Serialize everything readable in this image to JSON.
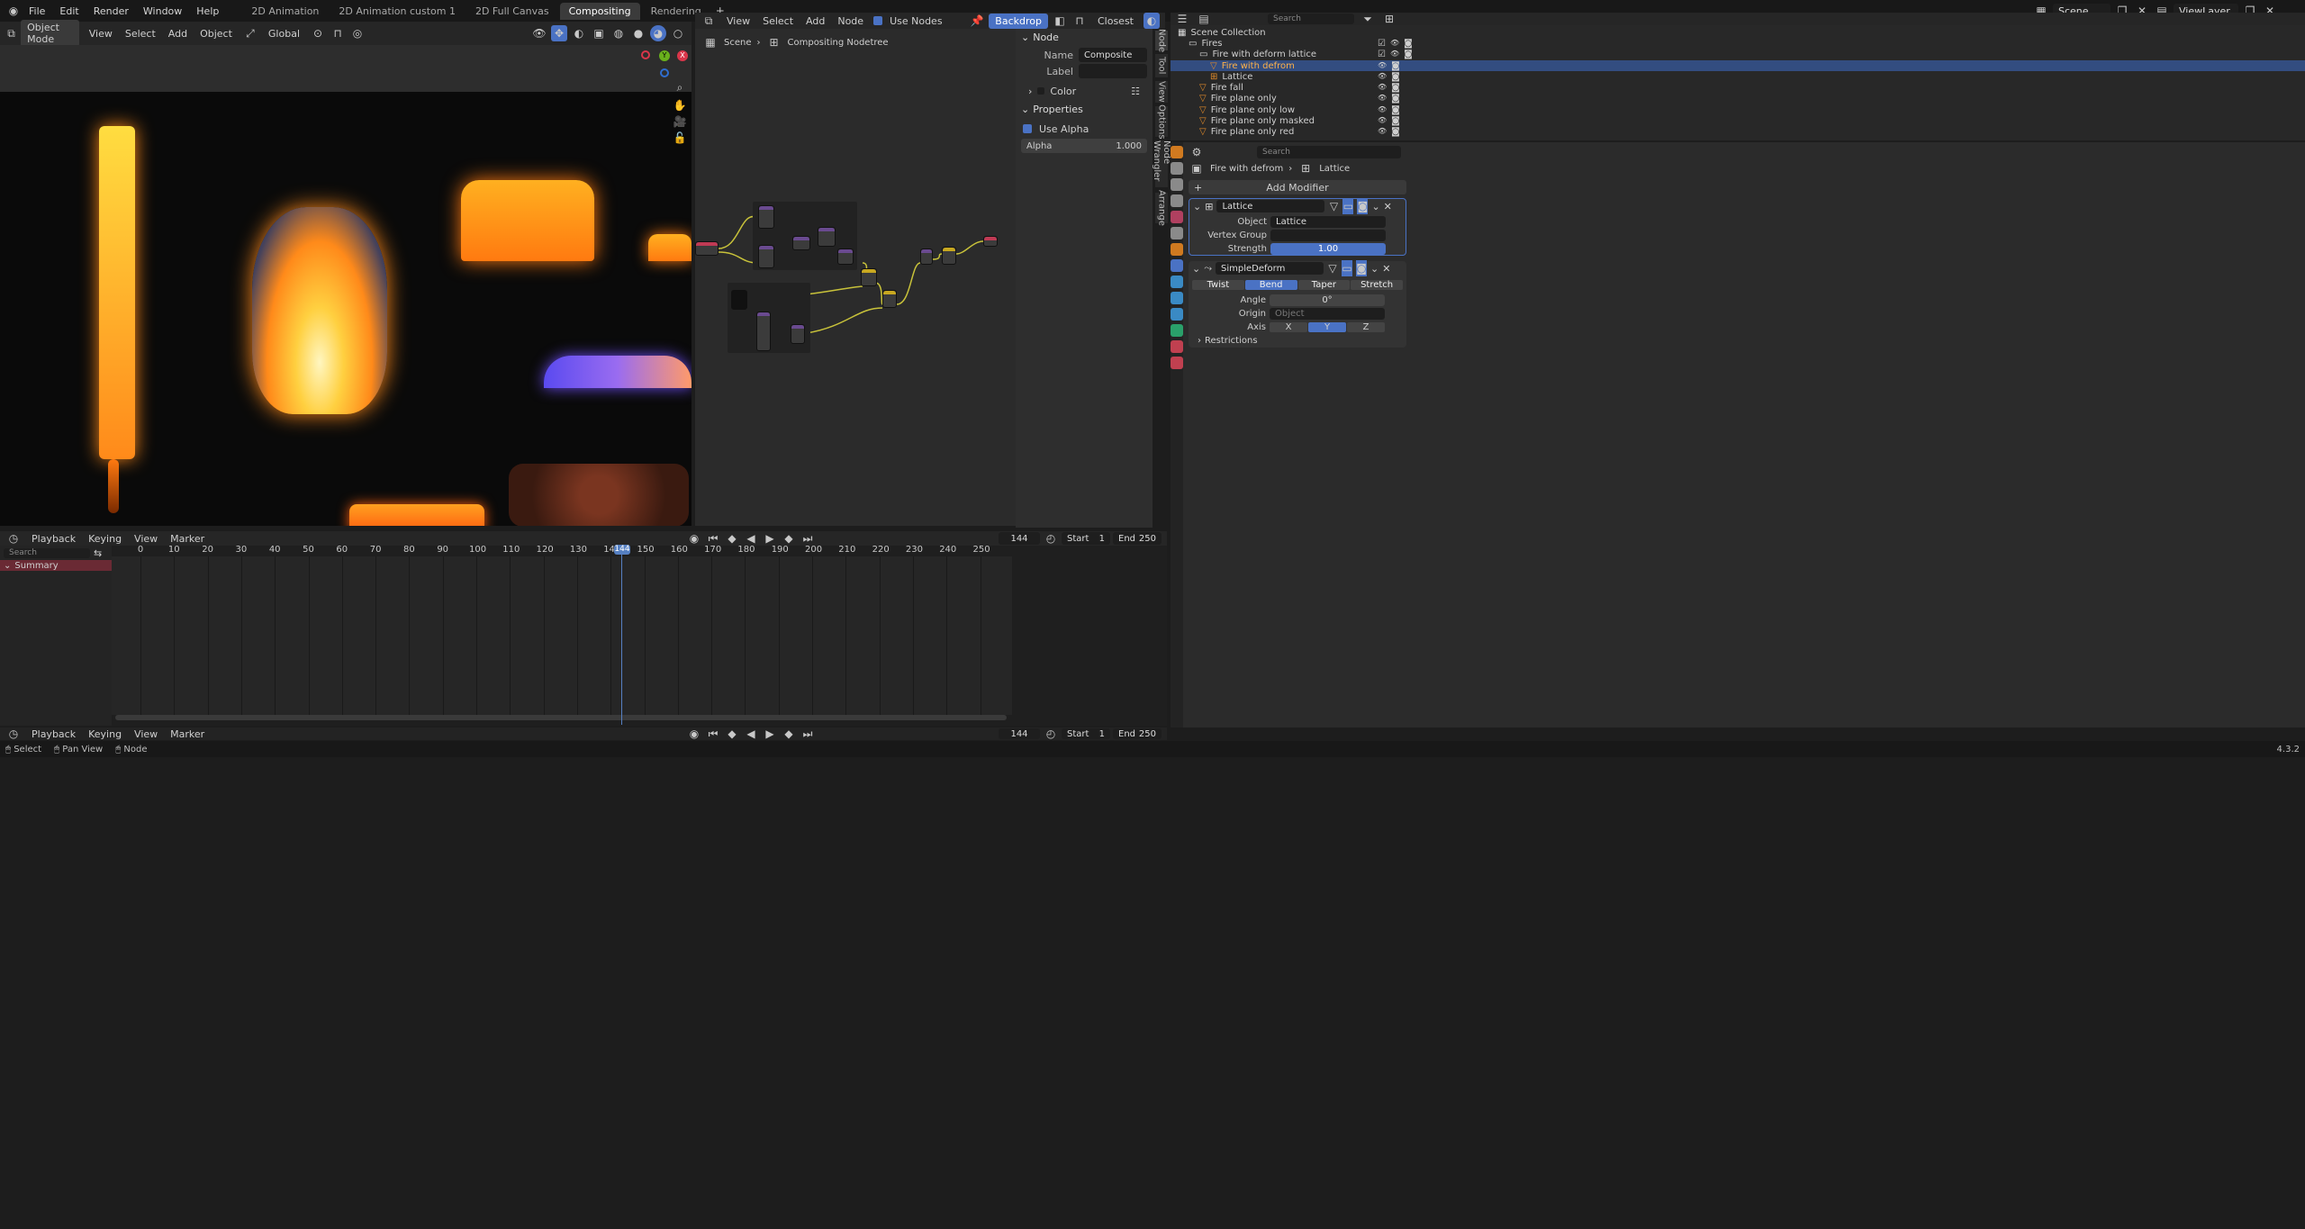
{
  "menu": [
    "File",
    "Edit",
    "Render",
    "Window",
    "Help"
  ],
  "workspaces": [
    {
      "label": "2D Animation",
      "active": false
    },
    {
      "label": "2D Animation custom 1",
      "active": false
    },
    {
      "label": "2D Full Canvas",
      "active": false
    },
    {
      "label": "Compositing",
      "active": true
    },
    {
      "label": "Rendering",
      "active": false
    }
  ],
  "scene": "Scene",
  "view_layer": "ViewLayer",
  "viewport": {
    "mode": "Object Mode",
    "menus": [
      "View",
      "Select",
      "Add",
      "Object"
    ],
    "orientation": "Global",
    "gizmo": {
      "z": "Z",
      "y": "Y",
      "x": "X"
    }
  },
  "node_editor": {
    "menus": [
      "View",
      "Select",
      "Add",
      "Node"
    ],
    "use_nodes": "Use Nodes",
    "backdrop": "Backdrop",
    "filter": "Closest",
    "breadcrumb": [
      "Scene",
      "Compositing Nodetree"
    ],
    "side_tabs": [
      "Node",
      "Tool",
      "View",
      "Options",
      "Node Wrangler",
      "Arrange"
    ],
    "panel": {
      "node_section": "Node",
      "name_label": "Name",
      "name_value": "Composite",
      "label_label": "Label",
      "label_value": "",
      "color_section": "Color",
      "properties_section": "Properties",
      "use_alpha": "Use Alpha",
      "alpha_label": "Alpha",
      "alpha_value": "1.000"
    }
  },
  "outliner": {
    "search_placeholder": "Search",
    "rows": [
      {
        "label": "Scene Collection",
        "indent": 0,
        "type": "scene",
        "selected": false
      },
      {
        "label": "Fires",
        "indent": 1,
        "type": "collection",
        "selected": false
      },
      {
        "label": "Fire with deform lattice",
        "indent": 2,
        "type": "collection",
        "selected": false
      },
      {
        "label": "Fire with defrom",
        "indent": 3,
        "type": "object",
        "selected": true
      },
      {
        "label": "Lattice",
        "indent": 3,
        "type": "lattice",
        "selected": false
      },
      {
        "label": "Fire fall",
        "indent": 2,
        "type": "object",
        "selected": false
      },
      {
        "label": "Fire plane only",
        "indent": 2,
        "type": "object",
        "selected": false
      },
      {
        "label": "Fire plane only low",
        "indent": 2,
        "type": "object",
        "selected": false
      },
      {
        "label": "Fire plane only masked",
        "indent": 2,
        "type": "object",
        "selected": false
      },
      {
        "label": "Fire plane only red",
        "indent": 2,
        "type": "object",
        "selected": false
      }
    ]
  },
  "properties": {
    "search_placeholder": "Search",
    "breadcrumb": [
      "Fire with defrom",
      "Lattice"
    ],
    "add_modifier": "Add Modifier",
    "lattice_mod": {
      "name": "Lattice",
      "object_label": "Object",
      "object_value": "Lattice",
      "vgroup_label": "Vertex Group",
      "strength_label": "Strength",
      "strength_value": "1.00"
    },
    "simple_deform": {
      "name": "SimpleDeform",
      "modes": [
        "Twist",
        "Bend",
        "Taper",
        "Stretch"
      ],
      "active_mode": "Bend",
      "angle_label": "Angle",
      "angle_value": "0°",
      "origin_label": "Origin",
      "origin_placeholder": "Object",
      "axis_label": "Axis",
      "axes": [
        "X",
        "Y",
        "Z"
      ],
      "active_axis": "Y",
      "restrictions": "Restrictions"
    }
  },
  "timeline": {
    "menus": [
      "Playback",
      "Keying",
      "View",
      "Marker"
    ],
    "search_placeholder": "Search",
    "summary": "Summary",
    "ticks": [
      "0",
      "10",
      "20",
      "30",
      "40",
      "50",
      "60",
      "70",
      "80",
      "90",
      "100",
      "110",
      "120",
      "130",
      "140",
      "150",
      "160",
      "170",
      "180",
      "190",
      "200",
      "210",
      "220",
      "230",
      "240",
      "250"
    ],
    "current_frame": "144",
    "start_label": "Start",
    "start_value": "1",
    "end_label": "End",
    "end_value": "250"
  },
  "status": {
    "items": [
      "Select",
      "Pan View",
      "Node"
    ],
    "version": "4.3.2"
  },
  "colors": {
    "accent": "#4a72c4",
    "selected_row": "#334d80",
    "playhead": "#5680c2",
    "fire_orange": "#ff9a1a",
    "fire_yellow": "#ffe04a"
  }
}
